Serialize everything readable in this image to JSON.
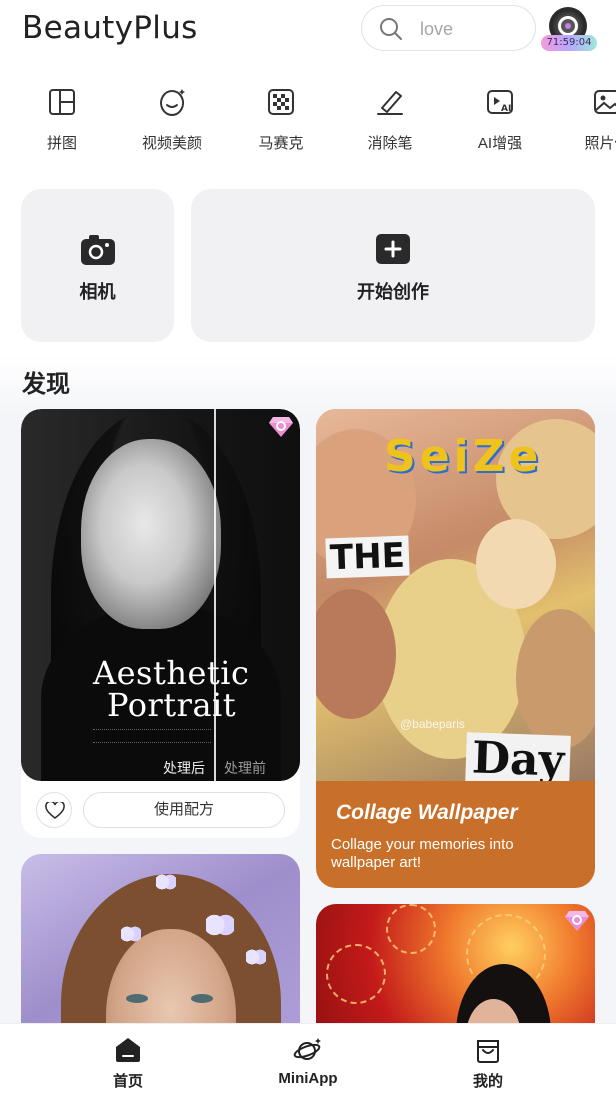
{
  "header": {
    "brand": "BeautyPlus",
    "search_placeholder": "love",
    "timer": "71:59:04"
  },
  "tools": [
    {
      "label": "拼图",
      "icon": "collage-icon"
    },
    {
      "label": "视频美颜",
      "icon": "face-beauty-icon"
    },
    {
      "label": "马赛克",
      "icon": "mosaic-icon"
    },
    {
      "label": "消除笔",
      "icon": "eraser-pen-icon"
    },
    {
      "label": "AI增强",
      "icon": "ai-enhance-icon"
    },
    {
      "label": "照片修",
      "icon": "photo-edit-icon"
    }
  ],
  "cards": {
    "camera": "相机",
    "create": "开始创作"
  },
  "discover": {
    "title": "发现",
    "post1": {
      "title_line1": "Aesthetic",
      "title_line2": "Portrait",
      "after_label": "处理后",
      "before_label": "处理前",
      "use_button": "使用配方"
    },
    "post2": {
      "title": "Collage Wallpaper",
      "description": "Collage your memories into wallpaper art!",
      "watermark": "@babeparis",
      "word_seize": "SeiZe",
      "word_the": "THE",
      "word_day": "Day"
    }
  },
  "tabbar": {
    "home": "首页",
    "miniapp": "MiniApp",
    "mine": "我的"
  }
}
